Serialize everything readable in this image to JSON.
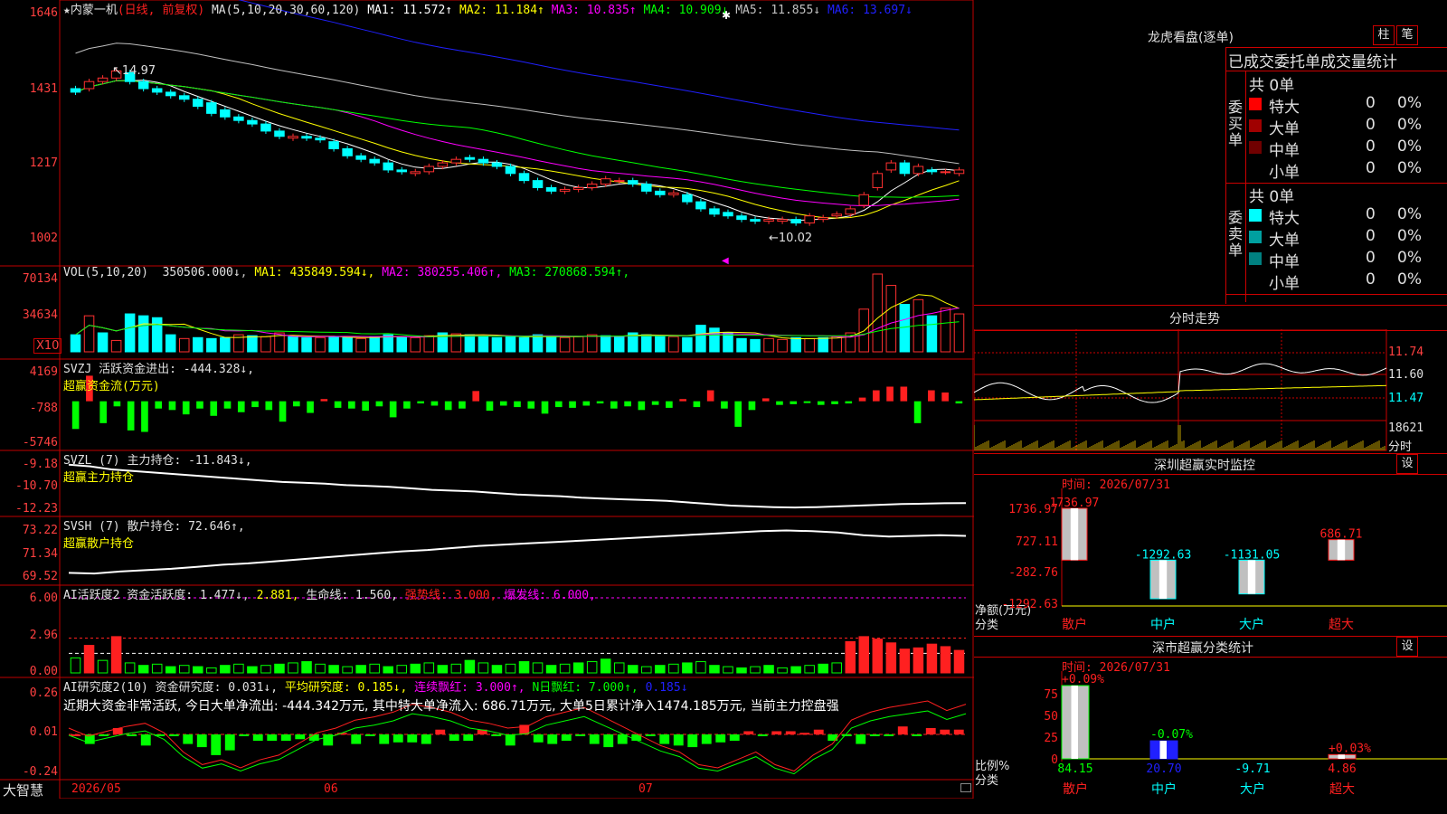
{
  "brand": "大智慧",
  "main": {
    "star": "★",
    "stock_name": "内蒙一机",
    "period": "(日线, 前复权)",
    "ma_params": "MA(5,10,20,30,60,120)",
    "ma_values": [
      {
        "label": "MA1: 11.572↑",
        "color": "#ffffff"
      },
      {
        "label": "MA2: 11.184↑",
        "color": "#ffff00"
      },
      {
        "label": "MA3: 10.835↑",
        "color": "#ff00ff"
      },
      {
        "label": "MA4: 10.909↓",
        "color": "#00ff00"
      },
      {
        "label": "MA5: 11.855↓",
        "color": "#c0c0c0"
      },
      {
        "label": "MA6: 13.697↓",
        "color": "#2020ff"
      }
    ],
    "y_ticks": [
      "1646",
      "1431",
      "1217",
      "1002"
    ],
    "high_mark": "14.97",
    "low_mark": "10.02"
  },
  "vol": {
    "title": "VOL(5,10,20)",
    "value": "350506.000↓",
    "ma": [
      {
        "label": "MA1: 435849.594↓",
        "color": "#ffff00"
      },
      {
        "label": "MA2: 380255.406↑",
        "color": "#ff00ff"
      },
      {
        "label": "MA3: 270868.594↑",
        "color": "#00ff00"
      }
    ],
    "y_ticks": [
      "70134",
      "34634"
    ],
    "unit": "X10"
  },
  "svzj": {
    "title": "SVZJ  活跃资金进出: -444.328↓,",
    "subtitle": "超赢资金流(万元)",
    "y_ticks": [
      "4169",
      "-788",
      "-5746"
    ]
  },
  "svzl": {
    "title": "SVZL (7) 主力持仓: -11.843↓,",
    "subtitle": "超赢主力持仓",
    "y_ticks": [
      "-9.18",
      "-10.70",
      "-12.23"
    ]
  },
  "svsh": {
    "title": "SVSH (7) 散户持仓: 72.646↑,",
    "subtitle": "超赢散户持仓",
    "y_ticks": [
      "73.22",
      "71.34",
      "69.52"
    ]
  },
  "ai1": {
    "title": "AI活跃度2 资金活跃度: 1.477↓",
    "v2": "2.881,",
    "life": "生命线: 1.560,",
    "strong": "强势线: 3.000,",
    "burst": "爆发线: 6.000,",
    "y_ticks": [
      "6.00",
      "2.96",
      "0.00"
    ]
  },
  "ai2": {
    "title": "AI研究度2(10) 资金研究度: 0.031↓,",
    "avg": "平均研究度: 0.185↓,",
    "lianxu": "连续飘红: 3.000↑,",
    "nday": "N日飘红: 7.000↑,",
    "last": "0.185↓",
    "comment": "近期大资金非常活跃, 今日大单净流出: -444.342万元, 其中特大单净流入: 686.71万元, 大单5日累计净入1474.185万元, 当前主力控盘强",
    "y_ticks": [
      "0.26",
      "0.01",
      "-0.24"
    ]
  },
  "xaxis": [
    "2026/05",
    "06",
    "07"
  ],
  "lhb": {
    "title": "龙虎看盘(逐单)",
    "btn1": "柱",
    "btn2": "笔",
    "header": "已成交委托单成交量统计",
    "buy_label": "委买单",
    "sell_label": "委卖单",
    "buy_total": "共 0单",
    "sell_total": "共 0单",
    "buy_rows": [
      {
        "name": "特大",
        "count": "0",
        "pct": "0%",
        "color": "#ff0000"
      },
      {
        "name": "大单",
        "count": "0",
        "pct": "0%",
        "color": "#a00000"
      },
      {
        "name": "中单",
        "count": "0",
        "pct": "0%",
        "color": "#700000"
      },
      {
        "name": "小单",
        "count": "0",
        "pct": "0%",
        "color": "#000000"
      }
    ],
    "sell_rows": [
      {
        "name": "特大",
        "count": "0",
        "pct": "0%",
        "color": "#00ffff"
      },
      {
        "name": "大单",
        "count": "0",
        "pct": "0%",
        "color": "#00a0a0"
      },
      {
        "name": "中单",
        "count": "0",
        "pct": "0%",
        "color": "#008080"
      },
      {
        "name": "小单",
        "count": "0",
        "pct": "0%",
        "color": "#000000"
      }
    ]
  },
  "intraday": {
    "title": "分时走势",
    "ticks": [
      "11.74",
      "11.60",
      "11.47"
    ],
    "vol_tick": "18621",
    "unit": "分时"
  },
  "sz_monitor": {
    "title": "深圳超赢实时监控",
    "btn": "设",
    "time": "时间: 2026/07/31",
    "y_ticks": [
      "1736.97",
      "727.11",
      "-282.76",
      "-1292.63"
    ],
    "ylabel1": "净额(万元)",
    "ylabel2": "分类",
    "bars": [
      {
        "cat": "散户",
        "value": 1736.97,
        "label": "1736.97"
      },
      {
        "cat": "中户",
        "value": -1292.63,
        "label": "-1292.63"
      },
      {
        "cat": "大户",
        "value": -1131.05,
        "label": "-1131.05"
      },
      {
        "cat": "超大",
        "value": 686.71,
        "label": "686.71"
      }
    ]
  },
  "sz_class": {
    "title": "深市超赢分类统计",
    "btn": "设",
    "time": "时间: 2026/07/31",
    "y_ticks": [
      "75",
      "50",
      "25",
      "0"
    ],
    "ylabel1": "比例%",
    "ylabel2": "分类",
    "bars": [
      {
        "cat": "散户",
        "value": 84.15,
        "label": "84.15",
        "top": "+0.09%"
      },
      {
        "cat": "中户",
        "value": 20.7,
        "label": "20.70",
        "top": "-0.07%"
      },
      {
        "cat": "大户",
        "value": -9.71,
        "label": "-9.71",
        "top": ""
      },
      {
        "cat": "超大",
        "value": 4.86,
        "label": "4.86",
        "top": "+0.03%"
      }
    ]
  },
  "chart_data": [
    {
      "type": "candlestick",
      "title": "内蒙一机 (日线, 前复权)",
      "x": [
        "2026/05",
        "06",
        "07"
      ],
      "ylim": [
        9.9,
        16.5
      ],
      "open": [
        14.3,
        14.3,
        14.5,
        14.6,
        14.75,
        14.5,
        14.3,
        14.2,
        14.1,
        14.0,
        13.9,
        13.7,
        13.5,
        13.4,
        13.3,
        13.1,
        12.9,
        12.95,
        12.9,
        12.8,
        12.6,
        12.4,
        12.3,
        12.2,
        12.0,
        11.9,
        11.95,
        12.1,
        12.2,
        12.35,
        12.3,
        12.2,
        12.1,
        11.9,
        11.7,
        11.5,
        11.4,
        11.45,
        11.5,
        11.6,
        11.7,
        11.7,
        11.6,
        11.4,
        11.3,
        11.3,
        11.1,
        10.9,
        10.8,
        10.7,
        10.6,
        10.55,
        10.55,
        10.6,
        10.5,
        10.6,
        10.7,
        10.75,
        11.0,
        11.5,
        12.0,
        12.2,
        11.9,
        12.0,
        11.95,
        11.9
      ],
      "close": [
        14.2,
        14.5,
        14.6,
        14.8,
        14.5,
        14.3,
        14.2,
        14.1,
        14.0,
        13.8,
        13.6,
        13.5,
        13.4,
        13.3,
        13.1,
        12.95,
        12.95,
        12.9,
        12.85,
        12.6,
        12.4,
        12.3,
        12.2,
        12.0,
        11.95,
        11.95,
        12.1,
        12.2,
        12.3,
        12.3,
        12.2,
        12.1,
        11.9,
        11.7,
        11.5,
        11.4,
        11.45,
        11.5,
        11.6,
        11.75,
        11.7,
        11.6,
        11.4,
        11.3,
        11.35,
        11.1,
        10.9,
        10.75,
        10.7,
        10.6,
        10.55,
        10.6,
        10.6,
        10.5,
        10.7,
        10.65,
        10.75,
        10.9,
        11.3,
        11.9,
        12.2,
        11.9,
        12.1,
        11.95,
        11.95,
        12.0
      ],
      "ma_series_names": [
        "MA1",
        "MA2",
        "MA3",
        "MA4",
        "MA5",
        "MA6"
      ],
      "high_label": 14.97,
      "low_label": 10.02
    },
    {
      "type": "bar",
      "title": "VOL(5,10,20)",
      "unit": "X10",
      "ylim": [
        0,
        82000
      ],
      "values": [
        18000,
        38000,
        20000,
        12000,
        40000,
        38000,
        36000,
        18000,
        14000,
        15000,
        14000,
        15000,
        18000,
        17000,
        16000,
        20000,
        16000,
        15000,
        15000,
        16000,
        15000,
        14000,
        16000,
        18000,
        16000,
        15000,
        17000,
        20000,
        19000,
        18000,
        16000,
        15000,
        16000,
        15000,
        18000,
        16000,
        15000,
        16000,
        18000,
        17000,
        16000,
        20000,
        18000,
        17000,
        16000,
        15000,
        28000,
        25000,
        20000,
        14000,
        13000,
        14000,
        13000,
        15000,
        14000,
        15000,
        16000,
        20000,
        45000,
        82000,
        70000,
        50000,
        55000,
        38000,
        46000,
        40000
      ],
      "up": [
        false,
        true,
        false,
        true,
        false,
        false,
        false,
        false,
        true,
        false,
        false,
        false,
        true,
        false,
        true,
        true,
        false,
        false,
        true,
        false,
        false,
        true,
        false,
        false,
        false,
        true,
        true,
        false,
        true,
        false,
        false,
        false,
        false,
        false,
        false,
        false,
        true,
        true,
        true,
        false,
        false,
        false,
        false,
        false,
        true,
        false,
        false,
        false,
        false,
        false,
        false,
        true,
        true,
        false,
        true,
        false,
        true,
        true,
        true,
        true,
        true,
        false,
        true,
        false,
        true,
        true
      ]
    },
    {
      "type": "bar",
      "title": "SVZJ 超赢资金流(万元)",
      "ylim": [
        -5746,
        4169
      ],
      "values": [
        -3800,
        3500,
        -3000,
        -700,
        -4000,
        -4200,
        -1000,
        -1200,
        -1800,
        -1000,
        -2000,
        -1000,
        -1500,
        -800,
        -1200,
        -2800,
        -700,
        -1600,
        300,
        -900,
        -1000,
        -1300,
        -700,
        -2200,
        -1000,
        -300,
        -600,
        -1200,
        -1000,
        1400,
        -1300,
        -600,
        -800,
        -1000,
        -1700,
        -800,
        -900,
        -600,
        -300,
        -1000,
        -700,
        -1200,
        -500,
        -900,
        300,
        -800,
        1500,
        -1000,
        -3500,
        -1200,
        400,
        -500,
        -400,
        -200,
        -500,
        -400,
        -300,
        500,
        1500,
        2000,
        2000,
        -3000,
        1500,
        1200,
        -300
      ]
    },
    {
      "type": "line",
      "title": "SVZL 超赢主力持仓",
      "ylim": [
        -12.23,
        -9.18
      ],
      "values": [
        -9.4,
        -9.5,
        -9.7,
        -9.8,
        -9.9,
        -10.0,
        -10.1,
        -10.2,
        -10.3,
        -10.4,
        -10.5,
        -10.55,
        -10.6,
        -10.7,
        -10.75,
        -10.8,
        -10.9,
        -11.0,
        -11.05,
        -11.1,
        -11.2,
        -11.3,
        -11.35,
        -11.4,
        -11.5,
        -11.55,
        -11.6,
        -11.65,
        -11.7,
        -11.8,
        -11.9,
        -12.0,
        -12.05,
        -12.1,
        -12.12,
        -12.1,
        -12.05,
        -12.0,
        -11.95,
        -11.9,
        -11.88,
        -11.85,
        -11.843
      ]
    },
    {
      "type": "line",
      "title": "SVSH 超赢散户持仓",
      "ylim": [
        69.52,
        73.22
      ],
      "values": [
        69.9,
        69.85,
        70.0,
        70.1,
        70.2,
        70.35,
        70.5,
        70.6,
        70.75,
        70.9,
        71.05,
        71.2,
        71.35,
        71.5,
        71.6,
        71.75,
        71.9,
        72.0,
        72.1,
        72.2,
        72.3,
        72.4,
        72.5,
        72.6,
        72.7,
        72.8,
        72.9,
        73.0,
        73.05,
        73.0,
        72.9,
        72.7,
        72.6,
        72.65,
        72.7,
        72.646
      ]
    },
    {
      "type": "bar",
      "title": "AI活跃度2",
      "ylim": [
        0,
        6.0
      ],
      "values": [
        1.2,
        2.2,
        1.0,
        2.9,
        0.8,
        0.6,
        0.7,
        0.5,
        0.6,
        0.5,
        0.4,
        0.6,
        0.7,
        0.5,
        0.6,
        0.7,
        0.8,
        0.9,
        0.7,
        0.6,
        0.5,
        0.6,
        0.7,
        0.5,
        0.6,
        0.7,
        0.8,
        0.6,
        0.7,
        1.0,
        0.8,
        0.6,
        0.7,
        0.9,
        0.8,
        0.6,
        0.7,
        0.8,
        0.9,
        1.1,
        0.8,
        0.6,
        0.5,
        0.6,
        0.7,
        0.8,
        0.9,
        0.6,
        0.5,
        0.4,
        0.5,
        0.6,
        0.4,
        0.5,
        0.6,
        0.7,
        0.8,
        2.5,
        2.9,
        2.7,
        2.4,
        1.9,
        2.0,
        2.3,
        2.1,
        1.8
      ],
      "lines": {
        "life": 1.56,
        "strong": 3.0,
        "burst": 6.0
      }
    },
    {
      "type": "bar",
      "title": "AI研究度2(10)",
      "ylim": [
        -0.24,
        0.26
      ],
      "values": [
        0.01,
        -0.05,
        0.0,
        0.05,
        0.0,
        -0.06,
        0.0,
        0.0,
        -0.05,
        -0.07,
        -0.12,
        -0.09,
        0.0,
        -0.03,
        -0.03,
        -0.03,
        -0.02,
        -0.03,
        -0.06,
        0.02,
        -0.05,
        0.0,
        -0.05,
        -0.04,
        -0.04,
        -0.05,
        0.04,
        -0.03,
        -0.03,
        0.04,
        0.0,
        -0.06,
        0.07,
        -0.04,
        -0.05,
        -0.03,
        0.0,
        -0.05,
        -0.07,
        -0.05,
        -0.03,
        0.0,
        -0.05,
        -0.06,
        -0.07,
        -0.05,
        -0.04,
        -0.03,
        0.03,
        0.0,
        0.03,
        0.03,
        0.02,
        0.04,
        -0.03,
        0.0,
        -0.05,
        0.0,
        0.0,
        0.06,
        0.0,
        0.05,
        0.04,
        0.04
      ],
      "line_values": [
        0.05,
        0.0,
        0.03,
        0.06,
        0.08,
        0.02,
        -0.1,
        -0.18,
        -0.15,
        -0.2,
        -0.15,
        -0.12,
        -0.05,
        0.02,
        0.05,
        0.1,
        0.12,
        0.15,
        0.2,
        0.18,
        0.15,
        0.1,
        0.08,
        0.05,
        0.06,
        0.12,
        0.15,
        0.18,
        0.12,
        0.06,
        0.0,
        -0.06,
        -0.1,
        -0.18,
        -0.2,
        -0.15,
        -0.1,
        -0.18,
        -0.22,
        -0.12,
        -0.05,
        0.1,
        0.15,
        0.18,
        0.2,
        0.22,
        0.16,
        0.2
      ]
    },
    {
      "type": "bar",
      "title": "深圳超赢实时监控",
      "categories": [
        "散户",
        "中户",
        "大户",
        "超大"
      ],
      "values": [
        1736.97,
        -1292.63,
        -1131.05,
        686.71
      ],
      "ylabel": "净额(万元)"
    },
    {
      "type": "bar",
      "title": "深市超赢分类统计",
      "categories": [
        "散户",
        "中户",
        "大户",
        "超大"
      ],
      "values": [
        84.15,
        20.7,
        -9.71,
        4.86
      ],
      "ylim": [
        0,
        80
      ],
      "ylabel": "比例%"
    }
  ]
}
